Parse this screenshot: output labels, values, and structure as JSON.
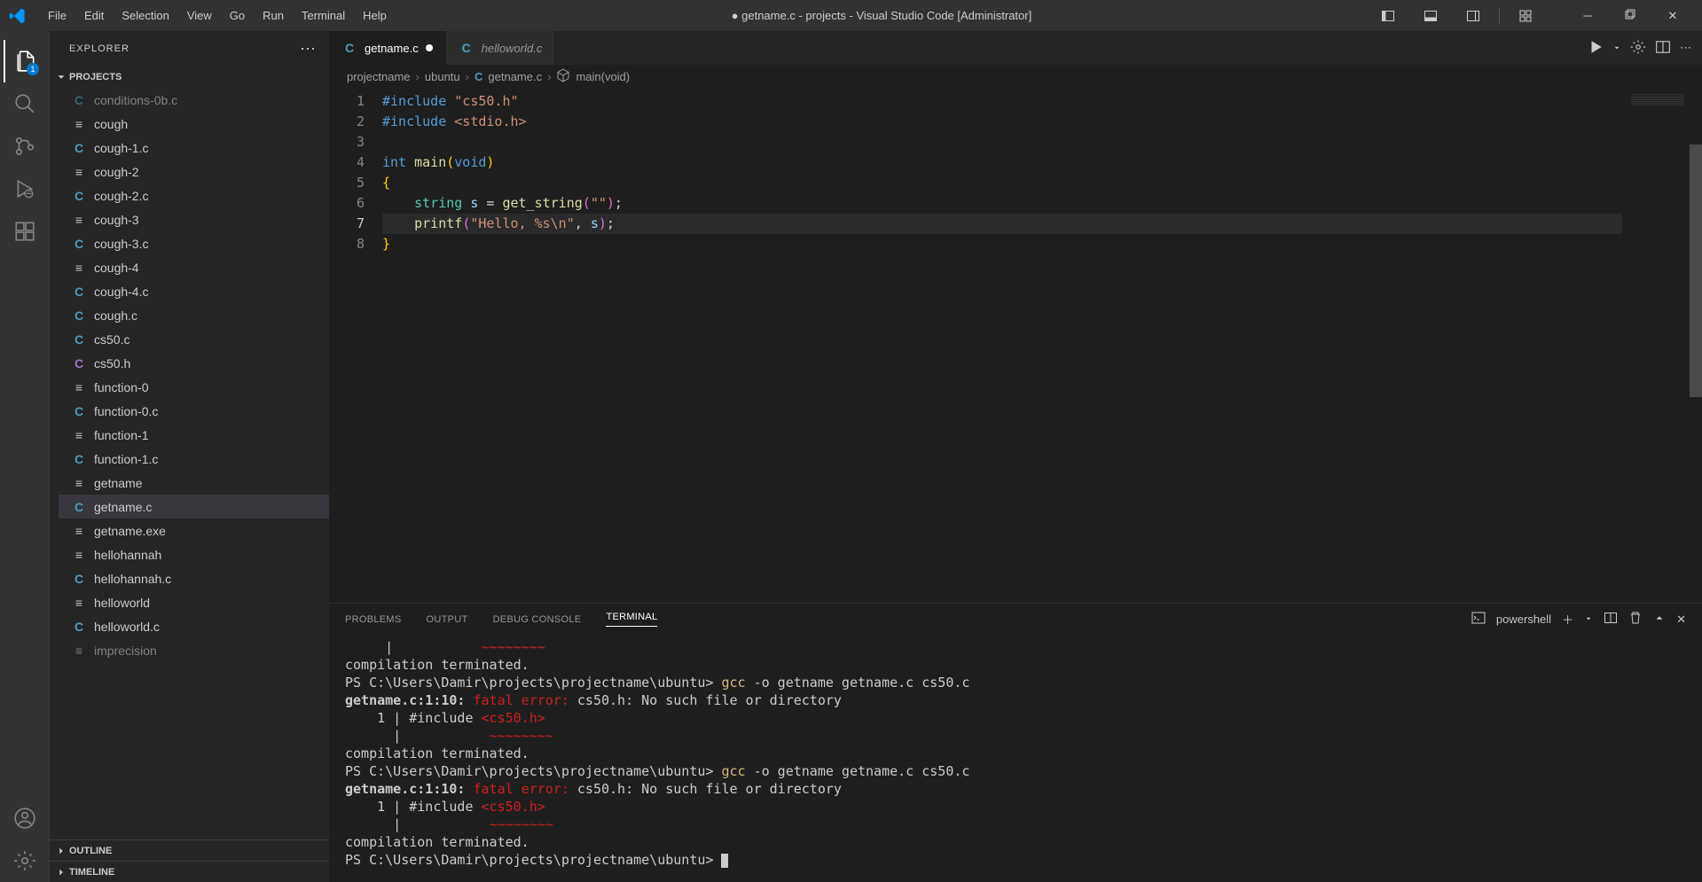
{
  "window_title": "● getname.c - projects - Visual Studio Code [Administrator]",
  "menu": [
    "File",
    "Edit",
    "Selection",
    "View",
    "Go",
    "Run",
    "Terminal",
    "Help"
  ],
  "activity_bar": {
    "explorer_badge": "1"
  },
  "sidebar": {
    "title": "EXPLORER",
    "project": "PROJECTS",
    "outline": "OUTLINE",
    "timeline": "TIMELINE",
    "files": [
      {
        "name": "conditions-0b.c",
        "icon": "c",
        "cut": true
      },
      {
        "name": "cough",
        "icon": "g"
      },
      {
        "name": "cough-1.c",
        "icon": "c"
      },
      {
        "name": "cough-2",
        "icon": "g"
      },
      {
        "name": "cough-2.c",
        "icon": "c"
      },
      {
        "name": "cough-3",
        "icon": "g"
      },
      {
        "name": "cough-3.c",
        "icon": "c"
      },
      {
        "name": "cough-4",
        "icon": "g"
      },
      {
        "name": "cough-4.c",
        "icon": "c"
      },
      {
        "name": "cough.c",
        "icon": "c"
      },
      {
        "name": "cs50.c",
        "icon": "c"
      },
      {
        "name": "cs50.h",
        "icon": "h"
      },
      {
        "name": "function-0",
        "icon": "g"
      },
      {
        "name": "function-0.c",
        "icon": "c"
      },
      {
        "name": "function-1",
        "icon": "g"
      },
      {
        "name": "function-1.c",
        "icon": "c"
      },
      {
        "name": "getname",
        "icon": "g"
      },
      {
        "name": "getname.c",
        "icon": "c",
        "active": true
      },
      {
        "name": "getname.exe",
        "icon": "g"
      },
      {
        "name": "hellohannah",
        "icon": "g"
      },
      {
        "name": "hellohannah.c",
        "icon": "c"
      },
      {
        "name": "helloworld",
        "icon": "g"
      },
      {
        "name": "helloworld.c",
        "icon": "c"
      },
      {
        "name": "imprecision",
        "icon": "g",
        "cut": true
      }
    ]
  },
  "tabs": [
    {
      "name": "getname.c",
      "icon": "c",
      "modified": true,
      "active": true
    },
    {
      "name": "helloworld.c",
      "icon": "c",
      "modified": false,
      "active": false,
      "italic": true
    }
  ],
  "breadcrumbs": {
    "parts": [
      "projectname",
      "ubuntu"
    ],
    "file": "getname.c",
    "symbol": "main(void)"
  },
  "code": {
    "lines": [
      1,
      2,
      3,
      4,
      5,
      6,
      7,
      8
    ],
    "current_line": 7
  },
  "panel": {
    "tabs": [
      "PROBLEMS",
      "OUTPUT",
      "DEBUG CONSOLE",
      "TERMINAL"
    ],
    "active": 3,
    "shell": "powershell"
  },
  "terminal": {
    "lines": [
      {
        "segs": [
          {
            "t": "     | "
          },
          {
            "t": "          ",
            "c": "red"
          },
          {
            "t": "~~~~~~~~",
            "c": "red"
          }
        ]
      },
      {
        "segs": [
          {
            "t": "compilation terminated."
          }
        ]
      },
      {
        "segs": [
          {
            "t": "PS C:\\Users\\Damir\\projects\\projectname\\ubuntu> "
          },
          {
            "t": "gcc ",
            "c": "yellow"
          },
          {
            "t": "-o getname getname.c cs50.c"
          }
        ]
      },
      {
        "segs": [
          {
            "t": "getname.c:1:10: ",
            "c": "bold"
          },
          {
            "t": "fatal error: ",
            "c": "red"
          },
          {
            "t": "cs50.h: No such file or directory"
          }
        ]
      },
      {
        "segs": [
          {
            "t": "    1 | #include "
          },
          {
            "t": "<cs50.h>",
            "c": "red"
          }
        ]
      },
      {
        "segs": [
          {
            "t": "      | "
          },
          {
            "t": "          ",
            "c": "red"
          },
          {
            "t": "~~~~~~~~",
            "c": "red"
          }
        ]
      },
      {
        "segs": [
          {
            "t": "compilation terminated."
          }
        ]
      },
      {
        "segs": [
          {
            "t": "PS C:\\Users\\Damir\\projects\\projectname\\ubuntu> "
          },
          {
            "t": "gcc ",
            "c": "yellow"
          },
          {
            "t": "-o getname getname.c cs50.c"
          }
        ]
      },
      {
        "segs": [
          {
            "t": "getname.c:1:10: ",
            "c": "bold"
          },
          {
            "t": "fatal error: ",
            "c": "red"
          },
          {
            "t": "cs50.h: No such file or directory"
          }
        ]
      },
      {
        "segs": [
          {
            "t": "    1 | #include "
          },
          {
            "t": "<cs50.h>",
            "c": "red"
          }
        ]
      },
      {
        "segs": [
          {
            "t": "      | "
          },
          {
            "t": "          ",
            "c": "red"
          },
          {
            "t": "~~~~~~~~",
            "c": "red"
          }
        ]
      },
      {
        "segs": [
          {
            "t": "compilation terminated."
          }
        ]
      },
      {
        "segs": [
          {
            "t": "PS C:\\Users\\Damir\\projects\\projectname\\ubuntu> "
          },
          {
            "cursor": true
          }
        ]
      }
    ]
  }
}
